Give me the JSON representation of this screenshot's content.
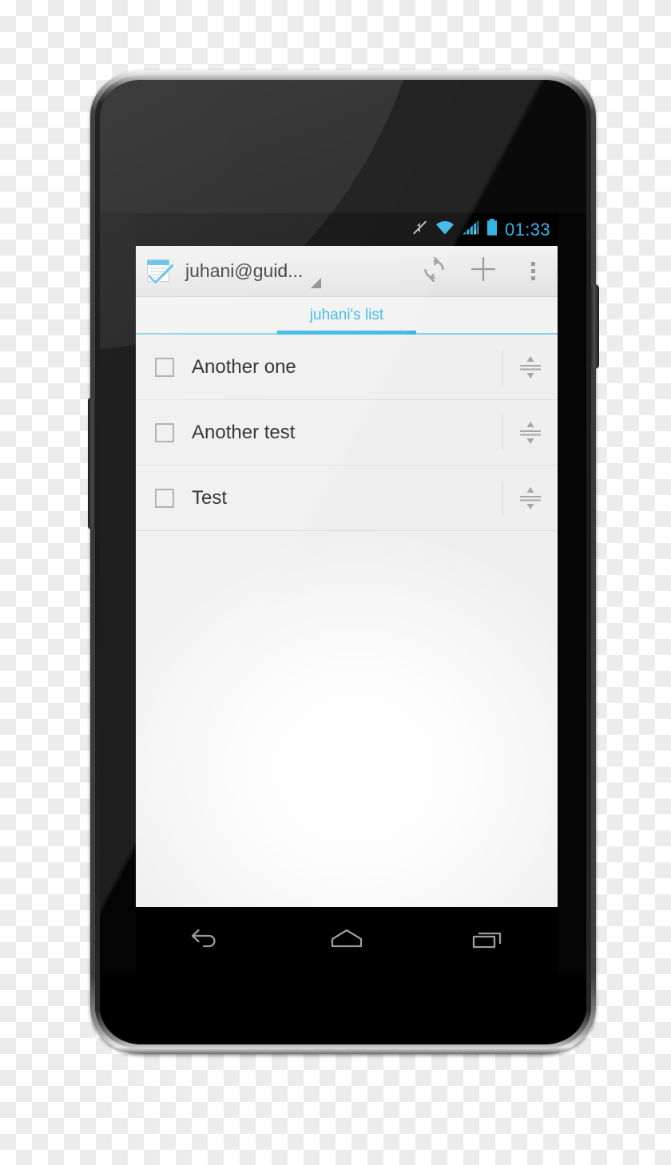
{
  "device": {
    "name": "android-smartphone",
    "hardware": {
      "earpiece": "earpiece-speaker",
      "proximity_sensor": "proximity-sensor",
      "light_sensor": "light-sensor",
      "front_camera": "front-camera",
      "volume_button": "volume-rocker",
      "power_button": "power-button"
    }
  },
  "status_bar": {
    "clock": "01:33",
    "icons": [
      {
        "name": "mute-icon",
        "label": "Silent mode"
      },
      {
        "name": "wifi-icon",
        "label": "Wi-Fi connected"
      },
      {
        "name": "signal-icon",
        "label": "Cellular signal"
      },
      {
        "name": "battery-icon",
        "label": "Battery"
      }
    ],
    "colors": {
      "accent": "#33b5e5",
      "background": "#000000"
    }
  },
  "action_bar": {
    "app_icon": "checklist-notepad-icon",
    "title": "juhani@guid...",
    "spinner_caret": "spinner-caret-icon",
    "actions": [
      {
        "name": "refresh-button",
        "icon": "refresh-icon",
        "label": "Sync"
      },
      {
        "name": "add-button",
        "icon": "plus-icon",
        "label": "Add"
      },
      {
        "name": "overflow-button",
        "icon": "overflow-menu-icon",
        "label": "More options"
      }
    ]
  },
  "tabs": {
    "selected_index": 0,
    "items": [
      {
        "label": "juhani's list"
      }
    ],
    "accent": "#33b5e5"
  },
  "task_list": {
    "items": [
      {
        "label": "Another one",
        "checked": false,
        "handle": "reorder-handle-icon"
      },
      {
        "label": "Another test",
        "checked": false,
        "handle": "reorder-handle-icon"
      },
      {
        "label": "Test",
        "checked": false,
        "handle": "reorder-handle-icon"
      }
    ]
  },
  "nav_bar": {
    "buttons": [
      {
        "name": "back-button",
        "icon": "back-arrow-icon",
        "label": "Back"
      },
      {
        "name": "home-button",
        "icon": "home-icon",
        "label": "Home"
      },
      {
        "name": "recents-button",
        "icon": "recents-icon",
        "label": "Recent apps"
      }
    ]
  }
}
